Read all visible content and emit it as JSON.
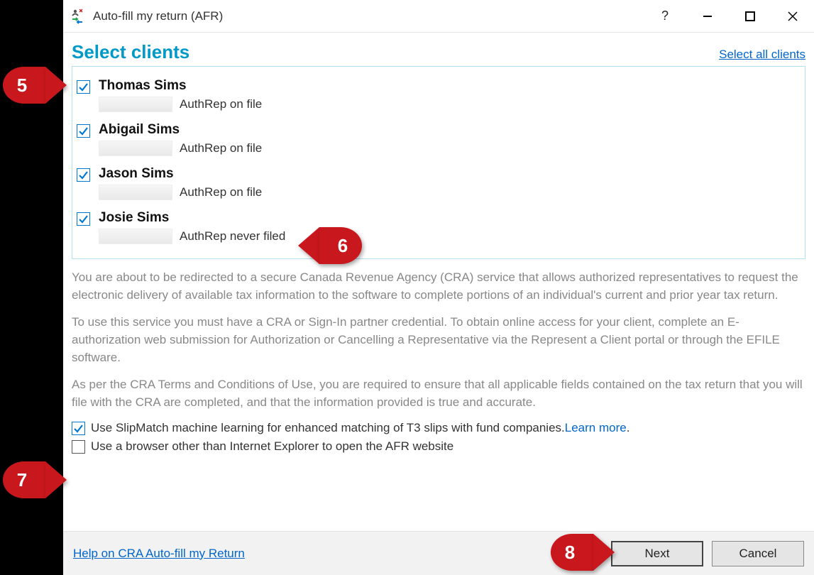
{
  "titlebar": {
    "title": "Auto-fill my return (AFR)",
    "help_symbol": "?"
  },
  "header": {
    "section_title": "Select clients",
    "select_all": "Select all clients"
  },
  "clients": [
    {
      "name": "Thomas Sims",
      "status": "AuthRep on file",
      "checked": true
    },
    {
      "name": "Abigail Sims",
      "status": "AuthRep on file",
      "checked": true
    },
    {
      "name": "Jason Sims",
      "status": "AuthRep on file",
      "checked": true
    },
    {
      "name": "Josie Sims",
      "status": "AuthRep never filed",
      "checked": true
    }
  ],
  "info": {
    "p1": "You are about to be redirected to a secure Canada Revenue Agency (CRA) service that allows authorized representatives to request the electronic delivery of available tax information to the software to complete portions of an individual's current and prior year tax return.",
    "p2": "To use this service you must have a CRA or Sign-In partner credential. To obtain online access for your client, complete an E-authorization web submission for Authorization or Cancelling a Representative via the Represent a Client portal or through the EFILE software.",
    "p3": "As per the CRA Terms and Conditions of Use, you are required to ensure that all applicable fields contained on the tax return that you will file with the CRA are completed, and that the information provided is true and accurate."
  },
  "options": {
    "slipmatch_label": "Use SlipMatch machine learning for enhanced matching of T3 slips with fund companies. ",
    "slipmatch_learn": "Learn more",
    "slipmatch_period": ".",
    "slipmatch_checked": true,
    "browser_label": "Use a browser other than Internet Explorer to open the AFR website",
    "browser_checked": false
  },
  "footer": {
    "help_link": "Help on CRA Auto-fill my Return",
    "next": "Next",
    "cancel": "Cancel"
  },
  "callouts": {
    "c5": "5",
    "c6": "6",
    "c7": "7",
    "c8": "8"
  }
}
